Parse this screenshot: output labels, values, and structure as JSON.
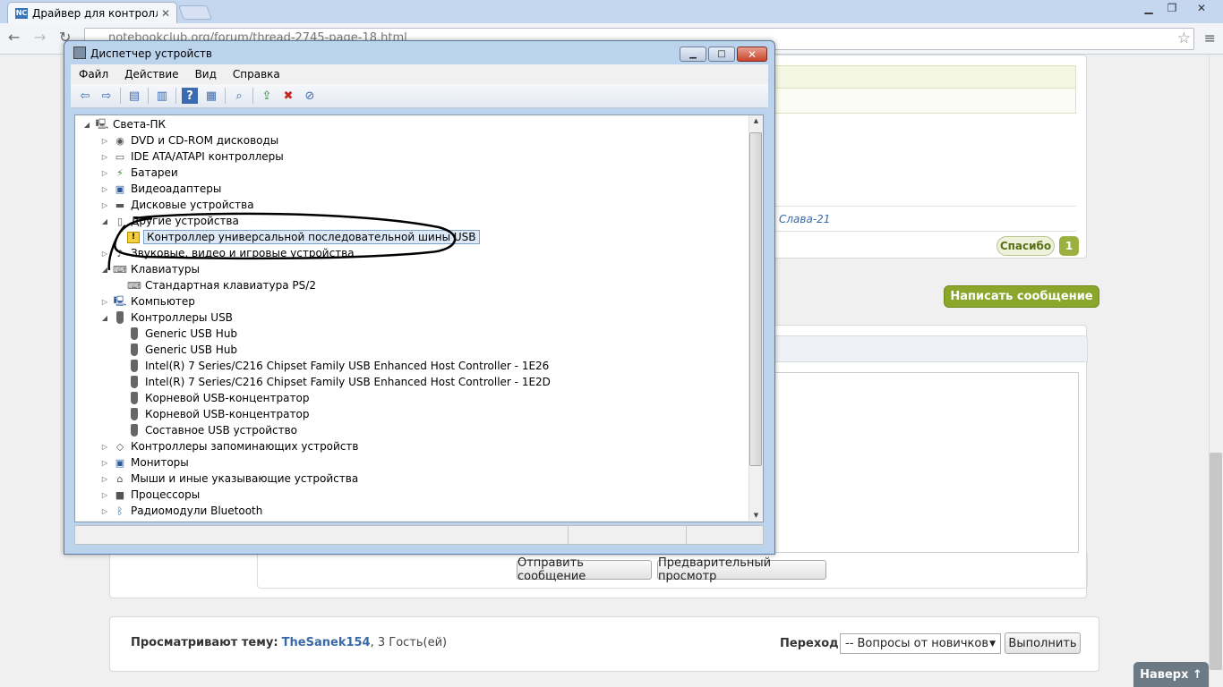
{
  "browser": {
    "tab_title": "Драйвер для контроллер",
    "tab_icon_text": "NC",
    "url": "notebookclub.org/forum/thread-2745-page-18.html"
  },
  "forum": {
    "post_author_link": "Слава-21",
    "thanks_button": "Спасибо",
    "thanks_count": "1",
    "write_message_button": "Написать сообщение",
    "send_button": "Отправить сообщение",
    "preview_button": "Предварительный просмотр",
    "viewing_label": "Просматривают тему:",
    "viewing_user": "TheSanek154",
    "viewing_guests": ", 3 Гость(ей)",
    "jump_label": "Переход:",
    "jump_selected": "-- Вопросы от новичков",
    "go_button": "Выполнить",
    "to_top": "Наверх ↑"
  },
  "device_manager": {
    "title": "Диспетчер устройств",
    "menu": [
      "Файл",
      "Действие",
      "Вид",
      "Справка"
    ],
    "tree": {
      "root": "Света-ПК",
      "items": [
        {
          "label": "DVD и CD-ROM дисководы"
        },
        {
          "label": "IDE ATA/ATAPI контроллеры"
        },
        {
          "label": "Батареи"
        },
        {
          "label": "Видеоадаптеры"
        },
        {
          "label": "Дисковые устройства"
        },
        {
          "label": "Другие устройства"
        },
        {
          "label": "Контроллер универсальной последовательной шины USB",
          "warning": true,
          "selected": true
        },
        {
          "label": "Звуковые, видео и игровые устройства"
        },
        {
          "label": "Клавиатуры"
        },
        {
          "label": "Стандартная клавиатура PS/2"
        },
        {
          "label": "Компьютер"
        },
        {
          "label": "Контроллеры USB"
        },
        {
          "label": "Generic USB Hub"
        },
        {
          "label": "Generic USB Hub"
        },
        {
          "label": "Intel(R) 7 Series/C216 Chipset Family USB Enhanced Host Controller - 1E26"
        },
        {
          "label": "Intel(R) 7 Series/C216 Chipset Family USB Enhanced Host Controller - 1E2D"
        },
        {
          "label": "Корневой USB-концентратор"
        },
        {
          "label": "Корневой USB-концентратор"
        },
        {
          "label": "Составное USB устройство"
        },
        {
          "label": "Контроллеры запоминающих устройств"
        },
        {
          "label": "Мониторы"
        },
        {
          "label": "Мыши и иные указывающие устройства"
        },
        {
          "label": "Процессоры"
        },
        {
          "label": "Радиомодули Bluetooth"
        }
      ]
    }
  },
  "colors": {
    "accent_green": "#8aa72b",
    "link_blue": "#3a6aa6",
    "selection": "#dde9f7"
  }
}
